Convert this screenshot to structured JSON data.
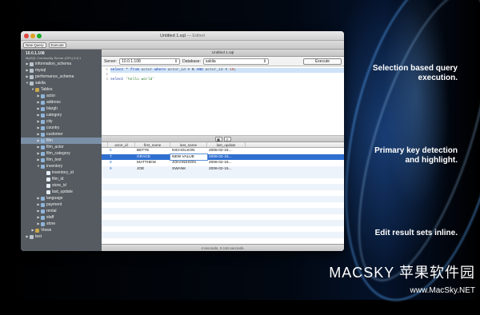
{
  "window": {
    "title": "Untitled 1.sql",
    "title_suffix": " — Edited",
    "editor_tab": "Untitled 1.sql",
    "footer": "4 seconds, 0.116 seconds."
  },
  "toolbar": {
    "new_query": "New Query",
    "execute": "Execute"
  },
  "server_info": {
    "host": "10.0.1.108",
    "version": "MySQL Community Server (GPL) 5.6.1"
  },
  "tree": [
    {
      "label": "information_schema",
      "level": 1,
      "arrow": "▶",
      "kind": "db"
    },
    {
      "label": "mysql",
      "level": 1,
      "arrow": "▶",
      "kind": "db"
    },
    {
      "label": "performance_schema",
      "level": 1,
      "arrow": "▶",
      "kind": "db"
    },
    {
      "label": "sakila",
      "level": 1,
      "arrow": "▼",
      "kind": "db"
    },
    {
      "label": "Tables",
      "level": 2,
      "arrow": "▼",
      "kind": "folder"
    },
    {
      "label": "actor",
      "level": 3,
      "arrow": "▶",
      "kind": "table"
    },
    {
      "label": "address",
      "level": 3,
      "arrow": "▶",
      "kind": "table"
    },
    {
      "label": "blargh",
      "level": 3,
      "arrow": "▶",
      "kind": "table"
    },
    {
      "label": "category",
      "level": 3,
      "arrow": "▶",
      "kind": "table"
    },
    {
      "label": "city",
      "level": 3,
      "arrow": "▶",
      "kind": "table"
    },
    {
      "label": "country",
      "level": 3,
      "arrow": "▶",
      "kind": "table"
    },
    {
      "label": "customer",
      "level": 3,
      "arrow": "▶",
      "kind": "table"
    },
    {
      "label": "film",
      "level": 3,
      "arrow": "▶",
      "kind": "table",
      "selected": true
    },
    {
      "label": "film_actor",
      "level": 3,
      "arrow": "▶",
      "kind": "table"
    },
    {
      "label": "film_category",
      "level": 3,
      "arrow": "▶",
      "kind": "table"
    },
    {
      "label": "film_text",
      "level": 3,
      "arrow": "▶",
      "kind": "table"
    },
    {
      "label": "inventory",
      "level": 3,
      "arrow": "▼",
      "kind": "table"
    },
    {
      "label": "inventory_id",
      "level": 4,
      "arrow": "",
      "kind": "column"
    },
    {
      "label": "film_id",
      "level": 4,
      "arrow": "",
      "kind": "column"
    },
    {
      "label": "store_id",
      "level": 4,
      "arrow": "",
      "kind": "column"
    },
    {
      "label": "last_update",
      "level": 4,
      "arrow": "",
      "kind": "column"
    },
    {
      "label": "language",
      "level": 3,
      "arrow": "▶",
      "kind": "table"
    },
    {
      "label": "payment",
      "level": 3,
      "arrow": "▶",
      "kind": "table"
    },
    {
      "label": "rental",
      "level": 3,
      "arrow": "▶",
      "kind": "table"
    },
    {
      "label": "staff",
      "level": 3,
      "arrow": "▶",
      "kind": "table"
    },
    {
      "label": "store",
      "level": 3,
      "arrow": "▶",
      "kind": "table"
    },
    {
      "label": "Views",
      "level": 2,
      "arrow": "▶",
      "kind": "folder"
    },
    {
      "label": "test",
      "level": 1,
      "arrow": "▶",
      "kind": "db"
    }
  ],
  "query_bar": {
    "server_label": "Server:",
    "server_value": "10.0.1.108",
    "database_label": "Database:",
    "database_value": "sakila",
    "execute_label": "Execute"
  },
  "editor": {
    "line_numbers": [
      "1",
      "2",
      "3"
    ],
    "line1": {
      "p1": "select",
      "p2": " * ",
      "p3": "from",
      "p4": " actor ",
      "p5": "where",
      "p6": " actor_id ",
      "p7": "> 5",
      "p8": " AND ",
      "p9": "actor_id",
      "p10": " < ",
      "p11": "10",
      "p12": ";"
    },
    "line3": {
      "p1": "select ",
      "p2": "'hello world'"
    }
  },
  "results": {
    "columns": [
      "actor_id",
      "first_name",
      "last_name",
      "last_update"
    ],
    "rows": [
      [
        "6",
        "BETTE",
        "NICHOLSON",
        "2006-02-15..."
      ],
      [
        "7",
        "GRACE",
        "NEW VALUE",
        "2006-02-15..."
      ],
      [
        "8",
        "MATTHEW",
        "JOHANSSON",
        "2006-02-15..."
      ],
      [
        "9",
        "JOE",
        "SWANK",
        "2006-02-15..."
      ]
    ]
  },
  "captions": {
    "c1": "Selection based query\nexecution.",
    "c2": "Primary key detection\nand highlight.",
    "c3": "Edit result sets inline."
  },
  "watermark": {
    "brand": "MACSKY 苹果软件园",
    "url": "www.MacSky.NET"
  },
  "colors": {
    "selection_blue": "#2f6fd0",
    "sidebar": "#555b60"
  }
}
